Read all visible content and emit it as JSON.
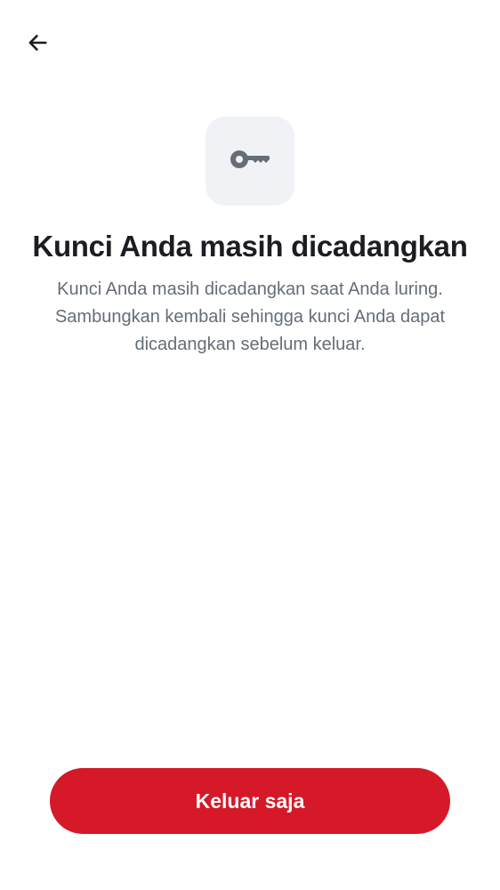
{
  "header": {
    "back_icon": "arrow-left-icon"
  },
  "illustration": {
    "icon": "key-icon",
    "tile_color": "#f0f2f5",
    "icon_color": "#656d77"
  },
  "content": {
    "title": "Kunci Anda masih dicadangkan",
    "description": "Kunci Anda masih dicadangkan saat Anda luring. Sambungkan kembali sehingga kunci Anda dapat dicadangkan sebelum keluar."
  },
  "actions": {
    "sign_out_label": "Keluar saja",
    "button_color": "#d51928"
  }
}
